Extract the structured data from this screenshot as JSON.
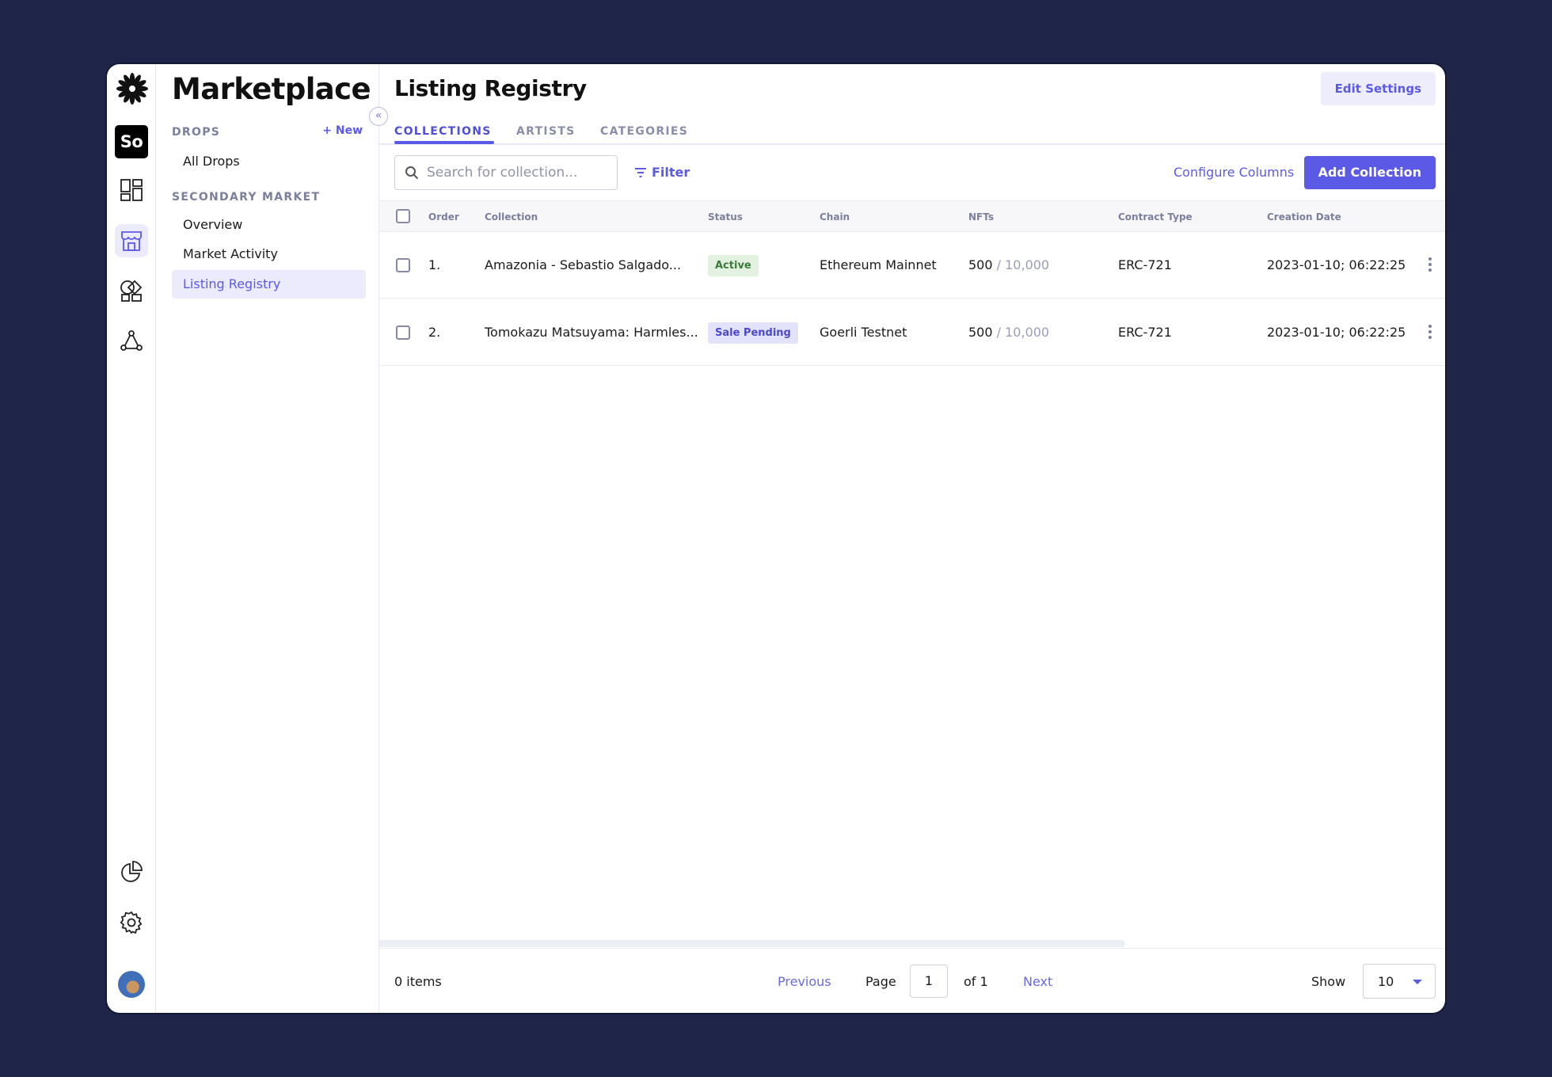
{
  "rail": {
    "org_badge": "So",
    "icons": [
      "flower-logo-icon",
      "dashboard-icon",
      "storefront-icon",
      "shapes-icon",
      "network-icon",
      "pie-chart-icon",
      "gear-icon",
      "user-avatar"
    ]
  },
  "subnav": {
    "title": "Marketplace",
    "drops_label": "DROPS",
    "new_label": "+ New",
    "drops_items": [
      "All Drops"
    ],
    "secondary_label": "SECONDARY MARKET",
    "secondary_items": [
      "Overview",
      "Market Activity",
      "Listing Registry"
    ],
    "active_item": "Listing Registry"
  },
  "header": {
    "title": "Listing Registry",
    "edit_settings": "Edit Settings"
  },
  "tabs": [
    "COLLECTIONS",
    "ARTISTS",
    "CATEGORIES"
  ],
  "active_tab": "COLLECTIONS",
  "toolbar": {
    "search_placeholder": "Search for collection...",
    "filter": "Filter",
    "configure_columns": "Configure Columns",
    "add_collection": "Add Collection"
  },
  "table": {
    "columns": [
      "Order",
      "Collection",
      "Status",
      "Chain",
      "NFTs",
      "Contract Type",
      "Creation Date"
    ],
    "rows": [
      {
        "order": "1.",
        "collection": "Amazonia - Sebastio Salgado...",
        "status": "Active",
        "chain": "Ethereum Mainnet",
        "nfts": "500",
        "nfts_total": "/ 10,000",
        "contract": "ERC-721",
        "date": "2023-01-10; 06:22:25"
      },
      {
        "order": "2.",
        "collection": "Tomokazu Matsuyama: Harmles...",
        "status": "Sale Pending",
        "chain": "Goerli Testnet",
        "nfts": "500",
        "nfts_total": "/ 10,000",
        "contract": "ERC-721",
        "date": "2023-01-10; 06:22:25"
      }
    ]
  },
  "footer": {
    "items": "0 items",
    "previous": "Previous",
    "page_label": "Page",
    "page_value": "1",
    "of_label": "of 1",
    "next": "Next",
    "show_label": "Show",
    "show_value": "10"
  },
  "colors": {
    "accent": "#5b5ae6",
    "background": "#1e2548",
    "active_badge_bg": "#e3f1e1",
    "pending_badge_bg": "#e3e2fb"
  }
}
